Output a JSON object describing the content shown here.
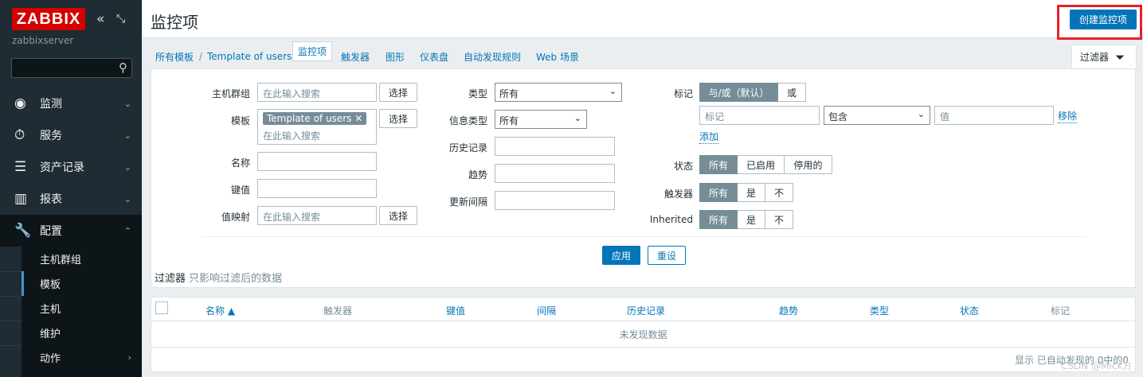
{
  "sidebar": {
    "logo": "ZABBIX",
    "server": "zabbixserver",
    "search_icon": "search-icon",
    "menu": [
      {
        "label": "监测",
        "icon": "eye-icon"
      },
      {
        "label": "服务",
        "icon": "clock-icon"
      },
      {
        "label": "资产记录",
        "icon": "list-icon"
      },
      {
        "label": "报表",
        "icon": "chart-icon"
      },
      {
        "label": "配置",
        "icon": "wrench-icon"
      }
    ],
    "submenu": [
      "主机群组",
      "模板",
      "主机",
      "维护",
      "动作"
    ]
  },
  "header": {
    "title": "监控项",
    "create_button": "创建监控项"
  },
  "breadcrumbs": {
    "all_templates": "所有模板",
    "separator": "/",
    "template": "Template of users",
    "items": "监控项",
    "triggers": "触发器",
    "graphs": "图形",
    "dashboards": "仪表盘",
    "discovery": "自动发现规则",
    "web": "Web 场景"
  },
  "filter": {
    "tab_label": "过滤器",
    "col1": {
      "host_group_label": "主机群组",
      "host_group_placeholder": "在此输入搜索",
      "template_label": "模板",
      "template_tag": "Template of users",
      "template_placeholder": "在此输入搜索",
      "name_label": "名称",
      "key_label": "键值",
      "valuemap_label": "值映射",
      "valuemap_placeholder": "在此输入搜索",
      "select_button": "选择"
    },
    "col2": {
      "type_label": "类型",
      "type_value": "所有",
      "info_type_label": "信息类型",
      "info_type_value": "所有",
      "history_label": "历史记录",
      "trends_label": "趋势",
      "interval_label": "更新间隔"
    },
    "col3": {
      "tags_label": "标记",
      "and_or": "与/或（默认）",
      "or": "或",
      "tag_placeholder": "标记",
      "operator": "包含",
      "value_placeholder": "值",
      "remove": "移除",
      "add": "添加",
      "state_label": "状态",
      "state_all": "所有",
      "state_enabled": "已启用",
      "state_disabled": "停用的",
      "trigger_label": "触发器",
      "inherited_label": "Inherited",
      "all": "所有",
      "yes": "是",
      "no": "不"
    },
    "apply": "应用",
    "reset": "重设",
    "note_bold": "过滤器",
    "note_rest": " 只影响过滤后的数据"
  },
  "table": {
    "columns": [
      "名称 ▲",
      "触发器",
      "键值",
      "间隔",
      "历史记录",
      "趋势",
      "类型",
      "状态",
      "标记"
    ],
    "empty": "未发现数据",
    "footer": "显示 已自动发现的 0中的0"
  },
  "watermark": "CSDN @Mick方"
}
